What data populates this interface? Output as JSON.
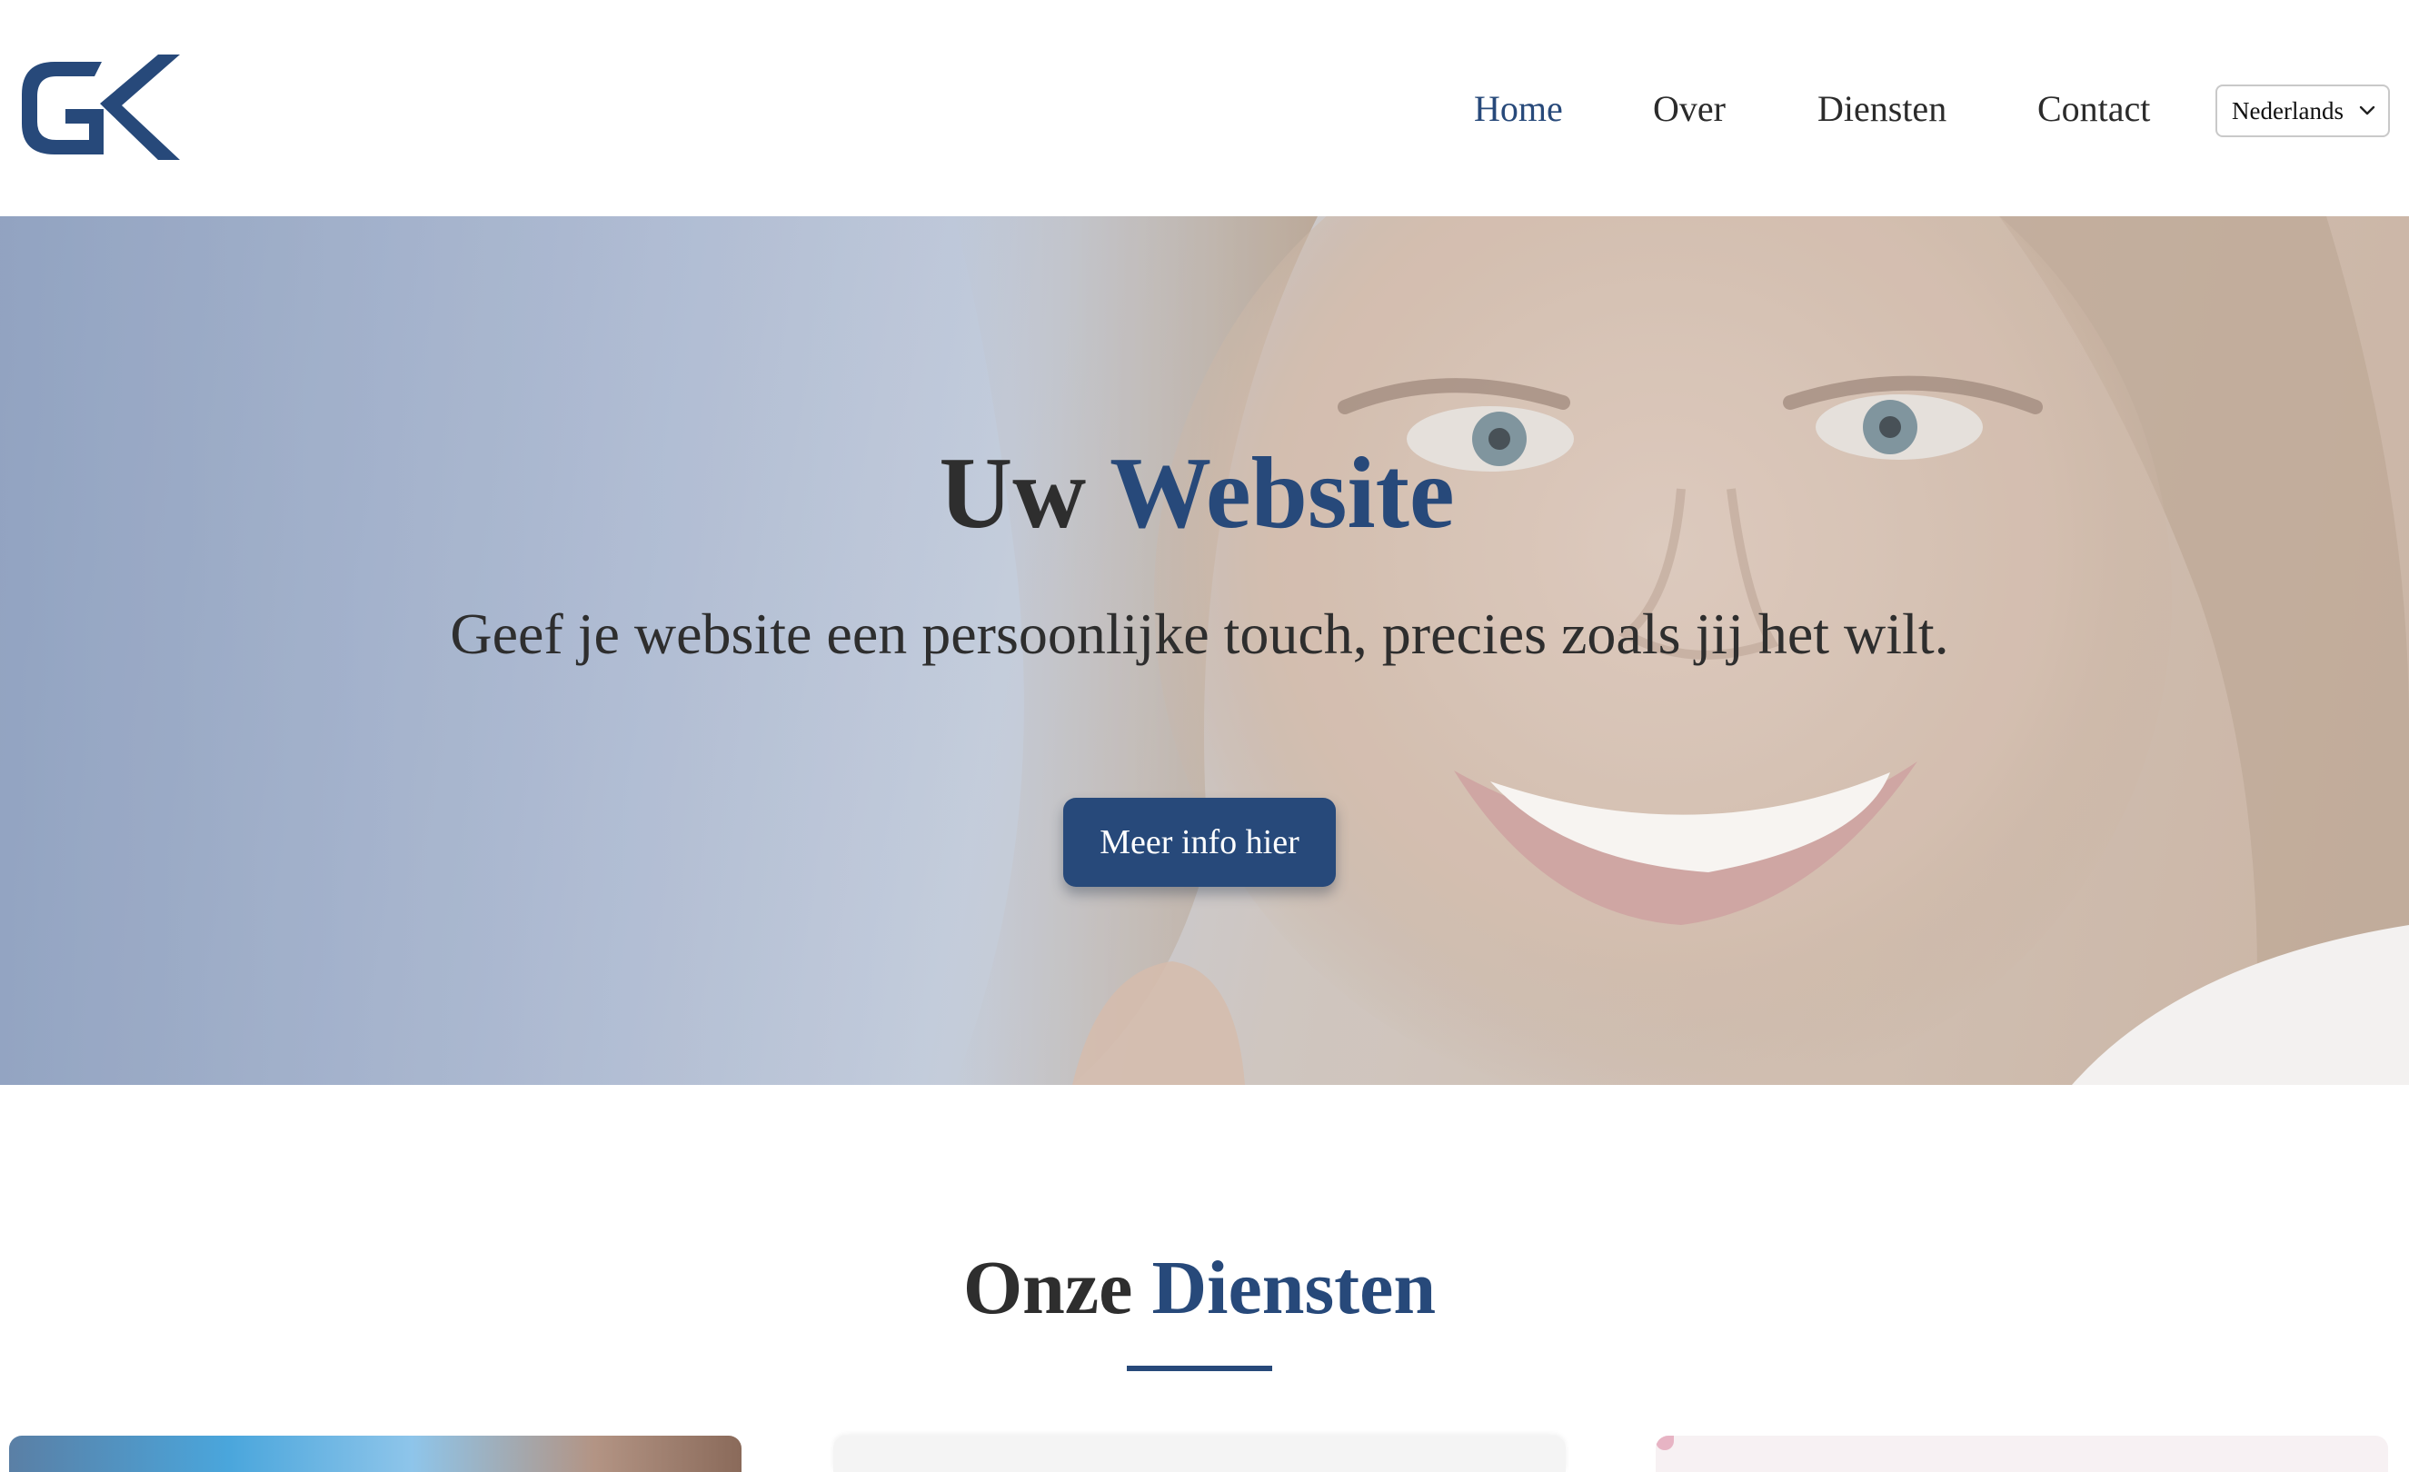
{
  "header": {
    "logo_text": "GK",
    "nav": [
      {
        "label": "Home",
        "active": true
      },
      {
        "label": "Over",
        "active": false
      },
      {
        "label": "Diensten",
        "active": false
      },
      {
        "label": "Contact",
        "active": false
      }
    ],
    "language": {
      "selected": "Nederlands"
    }
  },
  "hero": {
    "title_part1": "Uw",
    "title_part2": "Website",
    "subtitle": "Geef je website een persoonlijke touch, precies zoals jij het wilt.",
    "button_label": "Meer info hier"
  },
  "services": {
    "title_part1": "Onze",
    "title_part2": "Diensten"
  },
  "colors": {
    "accent": "#27497a",
    "text": "#2e2e2e",
    "background": "#ffffff"
  },
  "icons": {
    "language_dropdown": "chevron-down-icon",
    "logo": "gk-logo-icon"
  }
}
